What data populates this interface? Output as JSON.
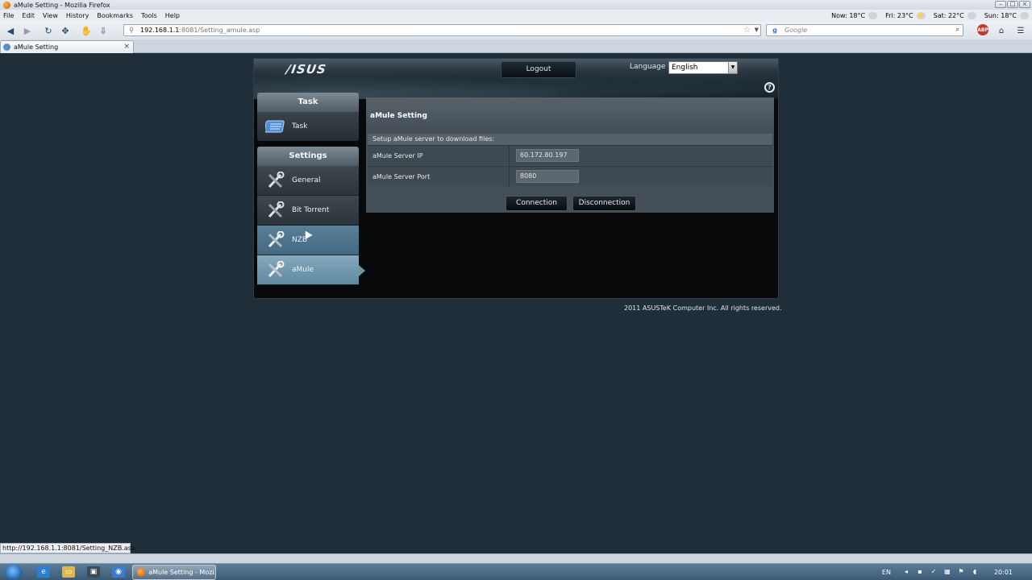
{
  "browser": {
    "window_title": "aMule Setting - Mozilla Firefox",
    "menu": [
      "File",
      "Edit",
      "View",
      "History",
      "Bookmarks",
      "Tools",
      "Help"
    ],
    "weather": [
      {
        "label": "Now: 18°C",
        "icon": "cloud-icon"
      },
      {
        "label": "Fri: 23°C",
        "icon": "sun-cloud-icon"
      },
      {
        "label": "Sat: 22°C",
        "icon": "cloud-icon"
      },
      {
        "label": "Sun: 18°C",
        "icon": "cloud-icon"
      }
    ],
    "url_host": "192.168.1.1",
    "url_path": ":8081/Setting_amule.asp",
    "search_placeholder": "Google",
    "tab_label": "aMule Setting",
    "status_url": "http://192.168.1.1:8081/Setting_NZB.asp"
  },
  "app": {
    "logo": "/ISUS",
    "logout_label": "Logout",
    "language_label": "Language",
    "language_value": "English",
    "help_glyph": "?",
    "sidebar": {
      "task_title": "Task",
      "task_item": "Task",
      "settings_title": "Settings",
      "items": [
        "General",
        "Bit Torrent",
        "NZB",
        "aMule"
      ],
      "hovered": "NZB",
      "active": "aMule"
    },
    "panel": {
      "title": "aMule Setting",
      "description": "Setup aMule server to download files:",
      "fields": [
        {
          "label": "aMule Server IP",
          "value": "60.172.80.197"
        },
        {
          "label": "aMule Server Port",
          "value": "8080"
        }
      ],
      "connect_label": "Connection",
      "disconnect_label": "Disconnection"
    },
    "copyright": "2011 ASUSTeK Computer Inc. All rights reserved."
  },
  "taskbar": {
    "task_label": "aMule Setting - Mozi...",
    "language": "EN",
    "clock": "20:01"
  }
}
